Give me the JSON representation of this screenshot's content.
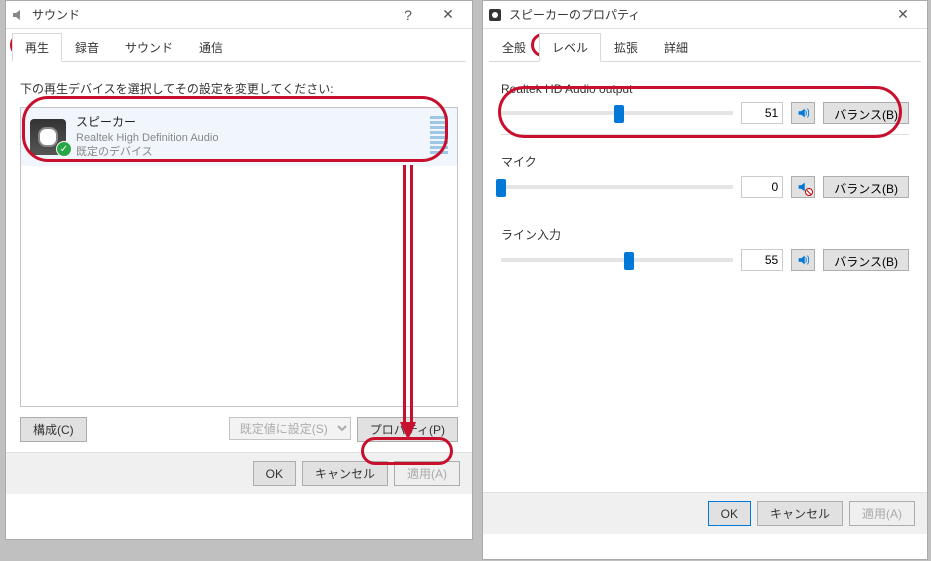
{
  "left": {
    "title": "サウンド",
    "tabs": [
      "再生",
      "録音",
      "サウンド",
      "通信"
    ],
    "active_tab": 0,
    "desc": "下の再生デバイスを選択してその設定を変更してください:",
    "device": {
      "name": "スピーカー",
      "driver": "Realtek High Definition Audio",
      "status": "既定のデバイス"
    },
    "buttons": {
      "configure": "構成(C)",
      "set_default": "既定値に設定(S)",
      "properties": "プロパティ(P)"
    },
    "dlg": {
      "ok": "OK",
      "cancel": "キャンセル",
      "apply": "適用(A)"
    }
  },
  "right": {
    "title": "スピーカーのプロパティ",
    "tabs": [
      "全般",
      "レベル",
      "拡張",
      "詳細"
    ],
    "active_tab": 1,
    "sections": [
      {
        "name": "Realtek HD Audio output",
        "value": 51,
        "muted": false,
        "balance": "バランス(B)"
      },
      {
        "name": "マイク",
        "value": 0,
        "muted": true,
        "balance": "バランス(B)"
      },
      {
        "name": "ライン入力",
        "value": 55,
        "muted": false,
        "balance": "バランス(B)"
      }
    ],
    "dlg": {
      "ok": "OK",
      "cancel": "キャンセル",
      "apply": "適用(A)"
    }
  }
}
